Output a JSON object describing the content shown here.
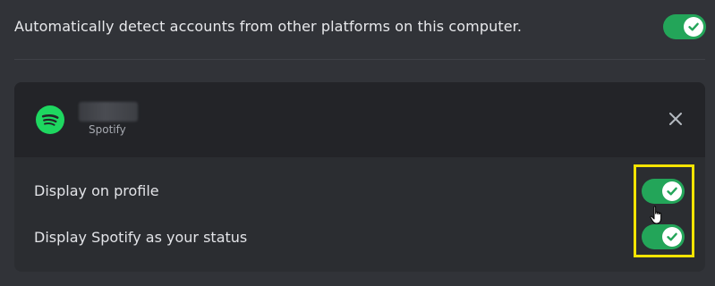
{
  "auto_detect": {
    "label": "Automatically detect accounts from other platforms on this computer.",
    "enabled": true
  },
  "connection": {
    "platform": "Spotify",
    "icon": "spotify-icon",
    "close_icon": "close-icon",
    "options": [
      {
        "label": "Display on profile",
        "enabled": true
      },
      {
        "label": "Display Spotify as your status",
        "enabled": true
      }
    ]
  },
  "colors": {
    "background": "#313338",
    "card": "#2b2d31",
    "card_header": "#232428",
    "toggle_on": "#23a559",
    "spotify_green": "#1ed760",
    "highlight": "#f5e400"
  }
}
